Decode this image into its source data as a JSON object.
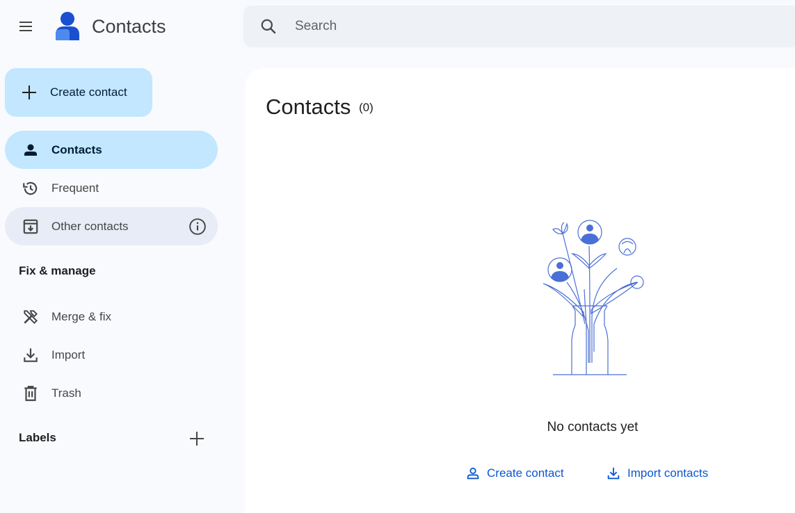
{
  "header": {
    "app_title": "Contacts",
    "menu_icon": "hamburger-menu-icon",
    "logo_icon": "contacts-logo-icon"
  },
  "search": {
    "placeholder": "Search",
    "value": "",
    "icon": "search-icon"
  },
  "sidebar": {
    "create_button": {
      "label": "Create contact",
      "icon": "plus-icon"
    },
    "nav_items": [
      {
        "label": "Contacts",
        "icon": "person-icon",
        "active": true
      },
      {
        "label": "Frequent",
        "icon": "history-icon",
        "active": false
      },
      {
        "label": "Other contacts",
        "icon": "archive-download-icon",
        "active": false,
        "info_icon": "info-icon"
      }
    ],
    "fix_manage": {
      "heading": "Fix & manage",
      "items": [
        {
          "label": "Merge & fix",
          "icon": "tools-icon"
        },
        {
          "label": "Import",
          "icon": "download-icon"
        },
        {
          "label": "Trash",
          "icon": "trash-icon"
        }
      ]
    },
    "labels": {
      "heading": "Labels",
      "add_icon": "plus-icon"
    }
  },
  "main": {
    "title": "Contacts",
    "count": "(0)",
    "empty_state": {
      "illustration": "flower-vase-illustration",
      "message": "No contacts yet",
      "actions": [
        {
          "label": "Create contact",
          "icon": "person-outline-icon"
        },
        {
          "label": "Import contacts",
          "icon": "download-icon"
        }
      ]
    }
  },
  "colors": {
    "background": "#f8fafd",
    "accent_light": "#c2e7ff",
    "link_blue": "#0b57d0",
    "illustration_blue": "#4a6fd6"
  }
}
